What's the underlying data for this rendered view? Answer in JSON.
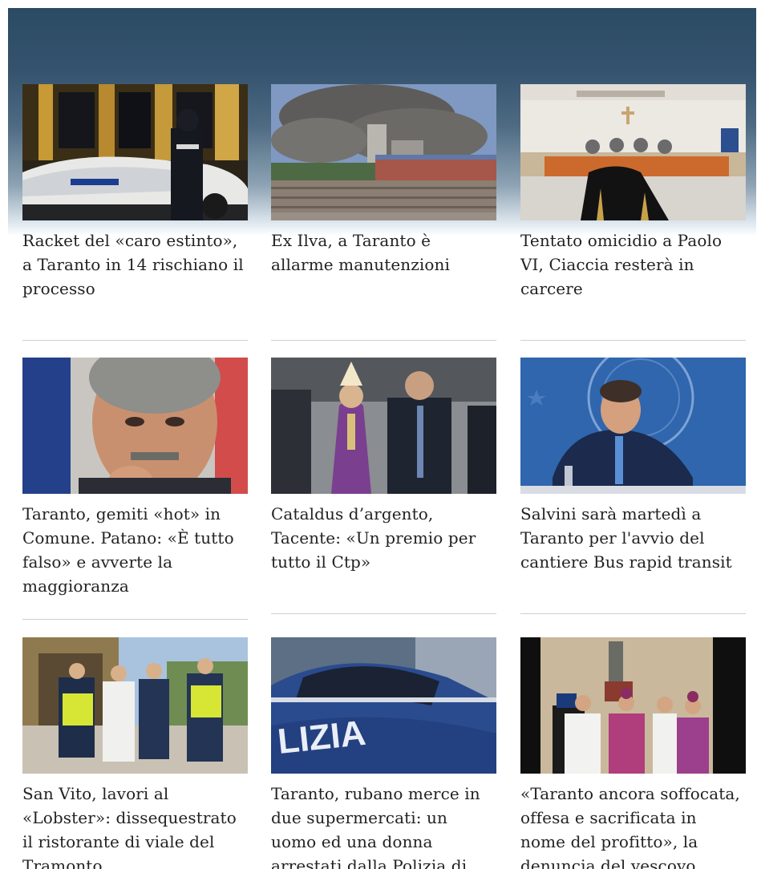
{
  "articles": [
    {
      "title": "Racket del «caro estinto», a Taranto in 14 rischiano il processo",
      "image": "police-car-night-image"
    },
    {
      "title": "Ex Ilva, a Taranto è allarme manutenzioni",
      "image": "industrial-smoke-image"
    },
    {
      "title": "Tentato omicidio a Paolo VI, Ciaccia resterà in carcere",
      "image": "courtroom-image"
    },
    {
      "title": "Taranto, gemiti «hot» in Comune. Patano: «È tutto falso» e avverte la maggioranza",
      "image": "politician-portrait-image"
    },
    {
      "title": "Cataldus d’argento, Tacente: «Un premio per tutto il Ctp»",
      "image": "bishop-ceremony-image"
    },
    {
      "title": "Salvini sarà martedì a Taranto per l'avvio del cantiere Bus rapid transit",
      "image": "press-conference-image"
    },
    {
      "title": "San Vito, lavori al «Lobster»: dissequestrato il ristorante di viale del Tramonto",
      "image": "police-officers-site-image"
    },
    {
      "title": "Taranto, rubano merce in due supermercati: un uomo ed una donna arrestati dalla Polizia di Stato",
      "image": "police-car-closeup-image"
    },
    {
      "title": "«Taranto ancora soffocata, offesa e sacrificata in nome del profitto», la denuncia del vescovo Miniero",
      "image": "religious-procession-image"
    }
  ],
  "colors": {
    "header_top": "#2b4a63",
    "header_mid": "#4e6b83",
    "divider": "#cfcfcf",
    "text": "#222222"
  }
}
